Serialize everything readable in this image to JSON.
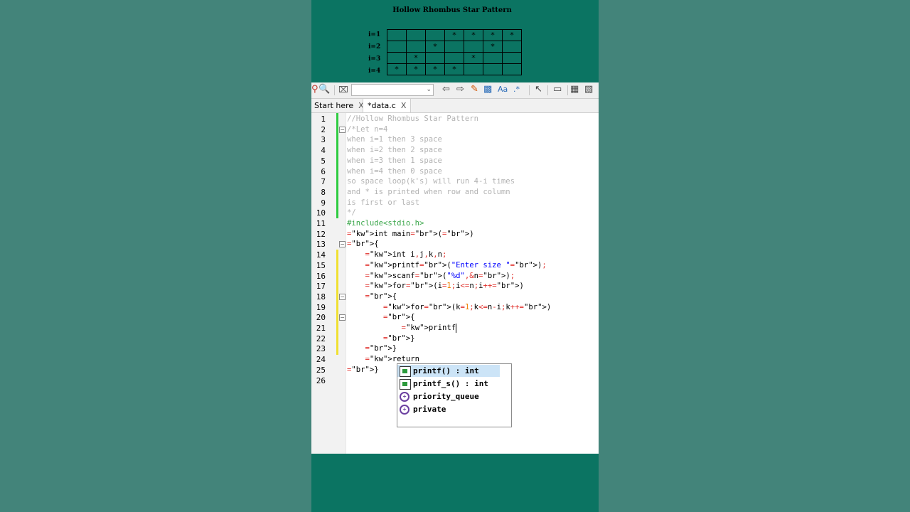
{
  "pattern": {
    "title": "Hollow Rhombus Star Pattern",
    "row_labels": [
      "i=1",
      "i=2",
      "i=3",
      "i=4"
    ],
    "grid": [
      [
        "",
        "",
        "",
        "*",
        "*",
        "*",
        "*"
      ],
      [
        "",
        "",
        "*",
        "",
        "",
        "*",
        ""
      ],
      [
        "",
        "*",
        "",
        "",
        "*",
        "",
        ""
      ],
      [
        "*",
        "*",
        "*",
        "*",
        "",
        "",
        ""
      ]
    ]
  },
  "toolbar": {
    "search_icon": "search-icon",
    "combo_value": ""
  },
  "tabs": [
    {
      "label": "Start here",
      "close": "X"
    },
    {
      "label": "*data.c",
      "close": "X"
    }
  ],
  "editor": {
    "lines": [
      {
        "n": "1",
        "text": "//Hollow Rhombus Star Pattern"
      },
      {
        "n": "2",
        "text": "/*Let n=4"
      },
      {
        "n": "3",
        "text": "when i=1 then 3 space"
      },
      {
        "n": "4",
        "text": "when i=2 then 2 space"
      },
      {
        "n": "5",
        "text": "when i=3 then 1 space"
      },
      {
        "n": "6",
        "text": "when i=4 then 0 space"
      },
      {
        "n": "7",
        "text": "so space loop(k's) will run 4-i times"
      },
      {
        "n": "8",
        "text": "and * is printed when row and column"
      },
      {
        "n": "9",
        "text": "is first or last"
      },
      {
        "n": "10",
        "text": "*/"
      },
      {
        "n": "11",
        "text": "#include<stdio.h>"
      },
      {
        "n": "12",
        "text": "int main()"
      },
      {
        "n": "13",
        "text": "{"
      },
      {
        "n": "14",
        "text": "    int i,j,k,n;"
      },
      {
        "n": "15",
        "text": "    printf(\"Enter size \");"
      },
      {
        "n": "16",
        "text": "    scanf(\"%d\",&n);"
      },
      {
        "n": "17",
        "text": "    for(i=1;i<=n;i++)"
      },
      {
        "n": "18",
        "text": "    {"
      },
      {
        "n": "19",
        "text": "        for(k=1;k<=n-i;k++)"
      },
      {
        "n": "20",
        "text": "        {"
      },
      {
        "n": "21",
        "text": "            printf"
      },
      {
        "n": "22",
        "text": "        }"
      },
      {
        "n": "23",
        "text": "    }"
      },
      {
        "n": "24",
        "text": "    return"
      },
      {
        "n": "25",
        "text": "}"
      },
      {
        "n": "26",
        "text": ""
      }
    ]
  },
  "autocomplete": {
    "items": [
      {
        "label": "printf() : int",
        "icon": "function-icon",
        "selected": true
      },
      {
        "label": "printf_s() : int",
        "icon": "function-icon",
        "selected": false
      },
      {
        "label": "priority_queue",
        "icon": "class-icon",
        "selected": false
      },
      {
        "label": "private",
        "icon": "class-icon",
        "selected": false
      }
    ]
  },
  "colors": {
    "background": "#43847a",
    "stripe": "#0b7462",
    "comment": "#b3b3b3",
    "preprocessor": "#3aa64a",
    "keyword": "#00005a",
    "string": "#0000ff",
    "number": "#f07f00",
    "operator": "#e0302b",
    "change_saved": "#2ecc40",
    "change_unsaved": "#f0e030"
  }
}
